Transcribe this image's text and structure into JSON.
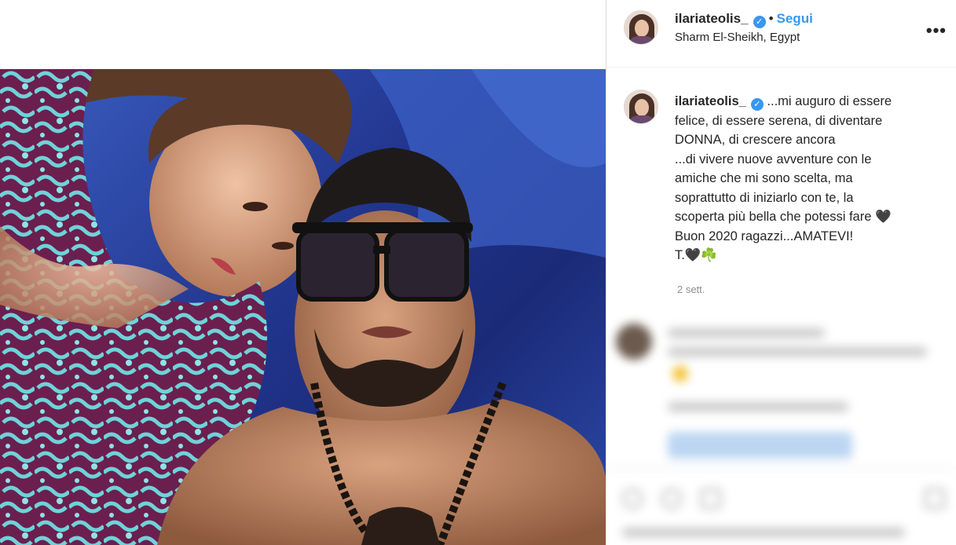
{
  "post": {
    "username": "ilariateolis_",
    "verified": true,
    "follow_label": "Segui",
    "separator": "•",
    "location": "Sharm El-Sheikh, Egypt",
    "more_label": "•••",
    "caption_lines": [
      "...mi auguro di essere",
      "felice, di essere serena, di diventare",
      "DONNA, di crescere ancora",
      "...di vivere nuove avventure con le",
      "amiche che mi sono scelta, ma",
      "soprattutto di iniziarlo con te, la",
      "scoperta più bella che potessi fare 🖤",
      "Buon 2020 ragazzi...AMATEVI!",
      "T.🖤☘️"
    ],
    "time_ago": "2 sett."
  },
  "colors": {
    "accent": "#3897f0",
    "text": "#262626",
    "muted": "#8e8e8e",
    "border": "#dbdbdb"
  },
  "icons": {
    "verified": "verified-badge-icon",
    "more": "more-options-icon"
  }
}
